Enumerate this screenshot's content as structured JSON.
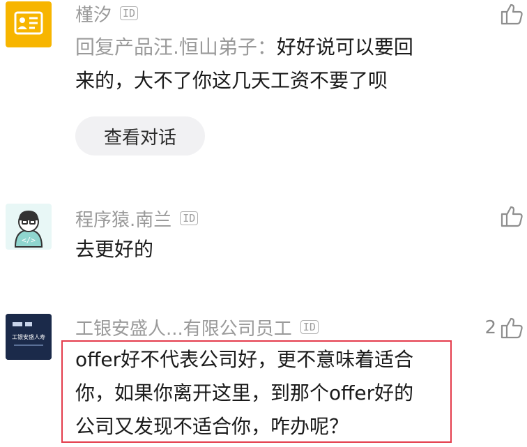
{
  "comments": [
    {
      "author": "槿汐",
      "id_badge": "ID",
      "reply_prefix": "回复产品汪.恒山弟子：",
      "lines": [
        "好好说可以要回",
        "来的，大不了你这几天工资不要了呗"
      ],
      "view_conversation": "查看对话",
      "likes": ""
    },
    {
      "author": "程序猿.南兰",
      "id_badge": "ID",
      "lines": [
        "去更好的"
      ],
      "avatar_code": "</>",
      "likes": ""
    },
    {
      "author": "工银安盛人...有限公司员工",
      "id_badge": "ID",
      "lines": [
        "offer好不代表公司好，更不意味着适合",
        "你，如果你离开这里，到那个offer好的",
        "公司又发现不适合你，咋办呢？"
      ],
      "avatar_text": "工银安盛人寿",
      "likes": "2"
    }
  ],
  "colors": {
    "highlight_border": "#e43c4c",
    "avatar_orange": "#f7b500",
    "avatar_teal": "#e8f7f6",
    "avatar_navy": "#1b2a4a"
  },
  "icons": [
    "thumbs-up-icon",
    "id-badge-icon",
    "code-icon"
  ]
}
